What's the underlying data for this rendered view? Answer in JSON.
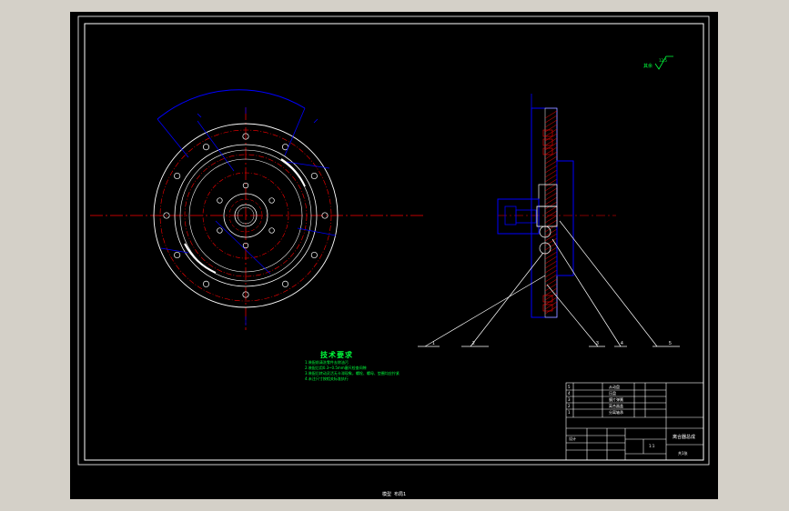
{
  "viewport": {
    "status_text": "模型 布局1",
    "background": "#000000"
  },
  "colors": {
    "frame": "#ffffff",
    "center": "#ff0000",
    "section": "#0000ff",
    "hatch": "#ff0000",
    "text": "#00ff3c",
    "dim": "#0000ff"
  },
  "roughness_mark": {
    "symbol": "其余",
    "value": "12.5"
  },
  "tech_requirements": {
    "title": "技术要求",
    "items": [
      "1.装配前清洗零件去除油污",
      "2.装配后用0.3~0.5mm塞尺检查间隙",
      "3.装配后转动灵活无卡滞现象，螺栓、螺母、垫圈均应拧紧",
      "4.未注尺寸按相关标准执行"
    ]
  },
  "balloons": [
    "1",
    "2",
    "3",
    "4",
    "5"
  ],
  "title_block": {
    "part_name": "离合器总成",
    "scale": "1:1",
    "sheet": "共1张",
    "drawn_by": "设计",
    "rows": [
      {
        "no": "5",
        "name": "从动盘"
      },
      {
        "no": "4",
        "name": "压盘"
      },
      {
        "no": "3",
        "name": "膜片弹簧"
      },
      {
        "no": "2",
        "name": "离合器盖"
      },
      {
        "no": "1",
        "name": "分离轴承"
      }
    ]
  }
}
